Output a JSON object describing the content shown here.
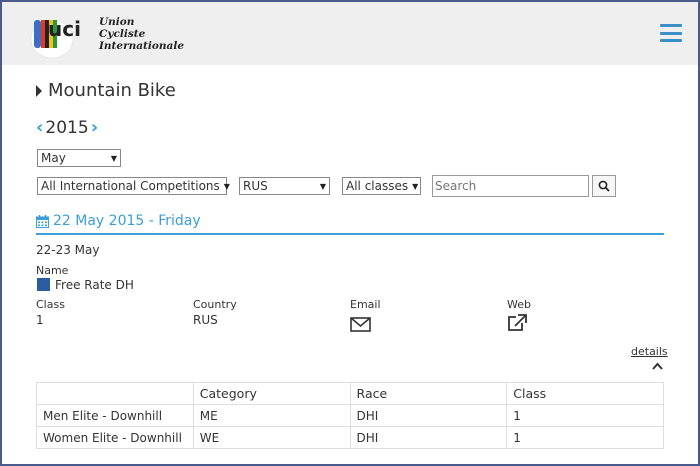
{
  "header": {
    "logo_mark": "uci",
    "logo_lines": [
      "Union",
      "Cycliste",
      "Internationale"
    ],
    "menu_icon": "hamburger-menu-icon"
  },
  "section_title": "Mountain Bike",
  "year": "2015",
  "filters": {
    "month": "May",
    "competition": "All International Competitions",
    "country": "RUS",
    "class": "All classes",
    "search_placeholder": "Search"
  },
  "event": {
    "date_heading": "22 May 2015 - Friday",
    "date_range": "22-23 May",
    "name_label": "Name",
    "name": "Free Rate DH",
    "class_label": "Class",
    "class_value": "1",
    "country_label": "Country",
    "country_value": "RUS",
    "email_label": "Email",
    "web_label": "Web",
    "details_link": "details"
  },
  "table": {
    "headers": [
      "",
      "Category",
      "Race",
      "Class"
    ],
    "rows": [
      [
        "Men Elite - Downhill",
        "ME",
        "DHI",
        "1"
      ],
      [
        "Women Elite - Downhill",
        "WE",
        "DHI",
        "1"
      ]
    ]
  },
  "colors": {
    "accent": "#3a9fd6",
    "frame": "#4a5a8a",
    "header_bg": "#efefef",
    "event_square": "#2a5da0"
  }
}
